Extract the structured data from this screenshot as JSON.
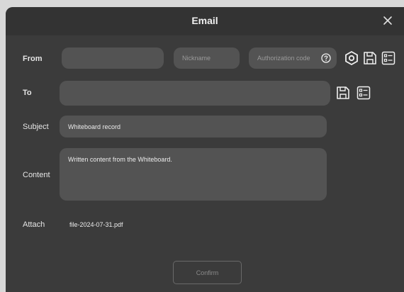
{
  "dialog": {
    "title": "Email"
  },
  "from": {
    "label": "From",
    "address_value": "",
    "nickname_placeholder": "Nickname",
    "authcode_placeholder": "Authorization code"
  },
  "to": {
    "label": "To",
    "value": ""
  },
  "subject": {
    "label": "Subject",
    "value": "Whiteboard record"
  },
  "content": {
    "label": "Content",
    "value": "Written content from the Whiteboard."
  },
  "attach": {
    "label": "Attach",
    "filename": "file-2024-07-31.pdf"
  },
  "confirm_label": "Confirm",
  "colors": {
    "dialog_bg": "#3b3b3b",
    "field_bg": "#535353",
    "text": "#e8e8e8",
    "placeholder": "#9a9a9a"
  },
  "icons": [
    "close-icon",
    "help-icon",
    "settings-icon",
    "save-icon",
    "contacts-icon"
  ]
}
